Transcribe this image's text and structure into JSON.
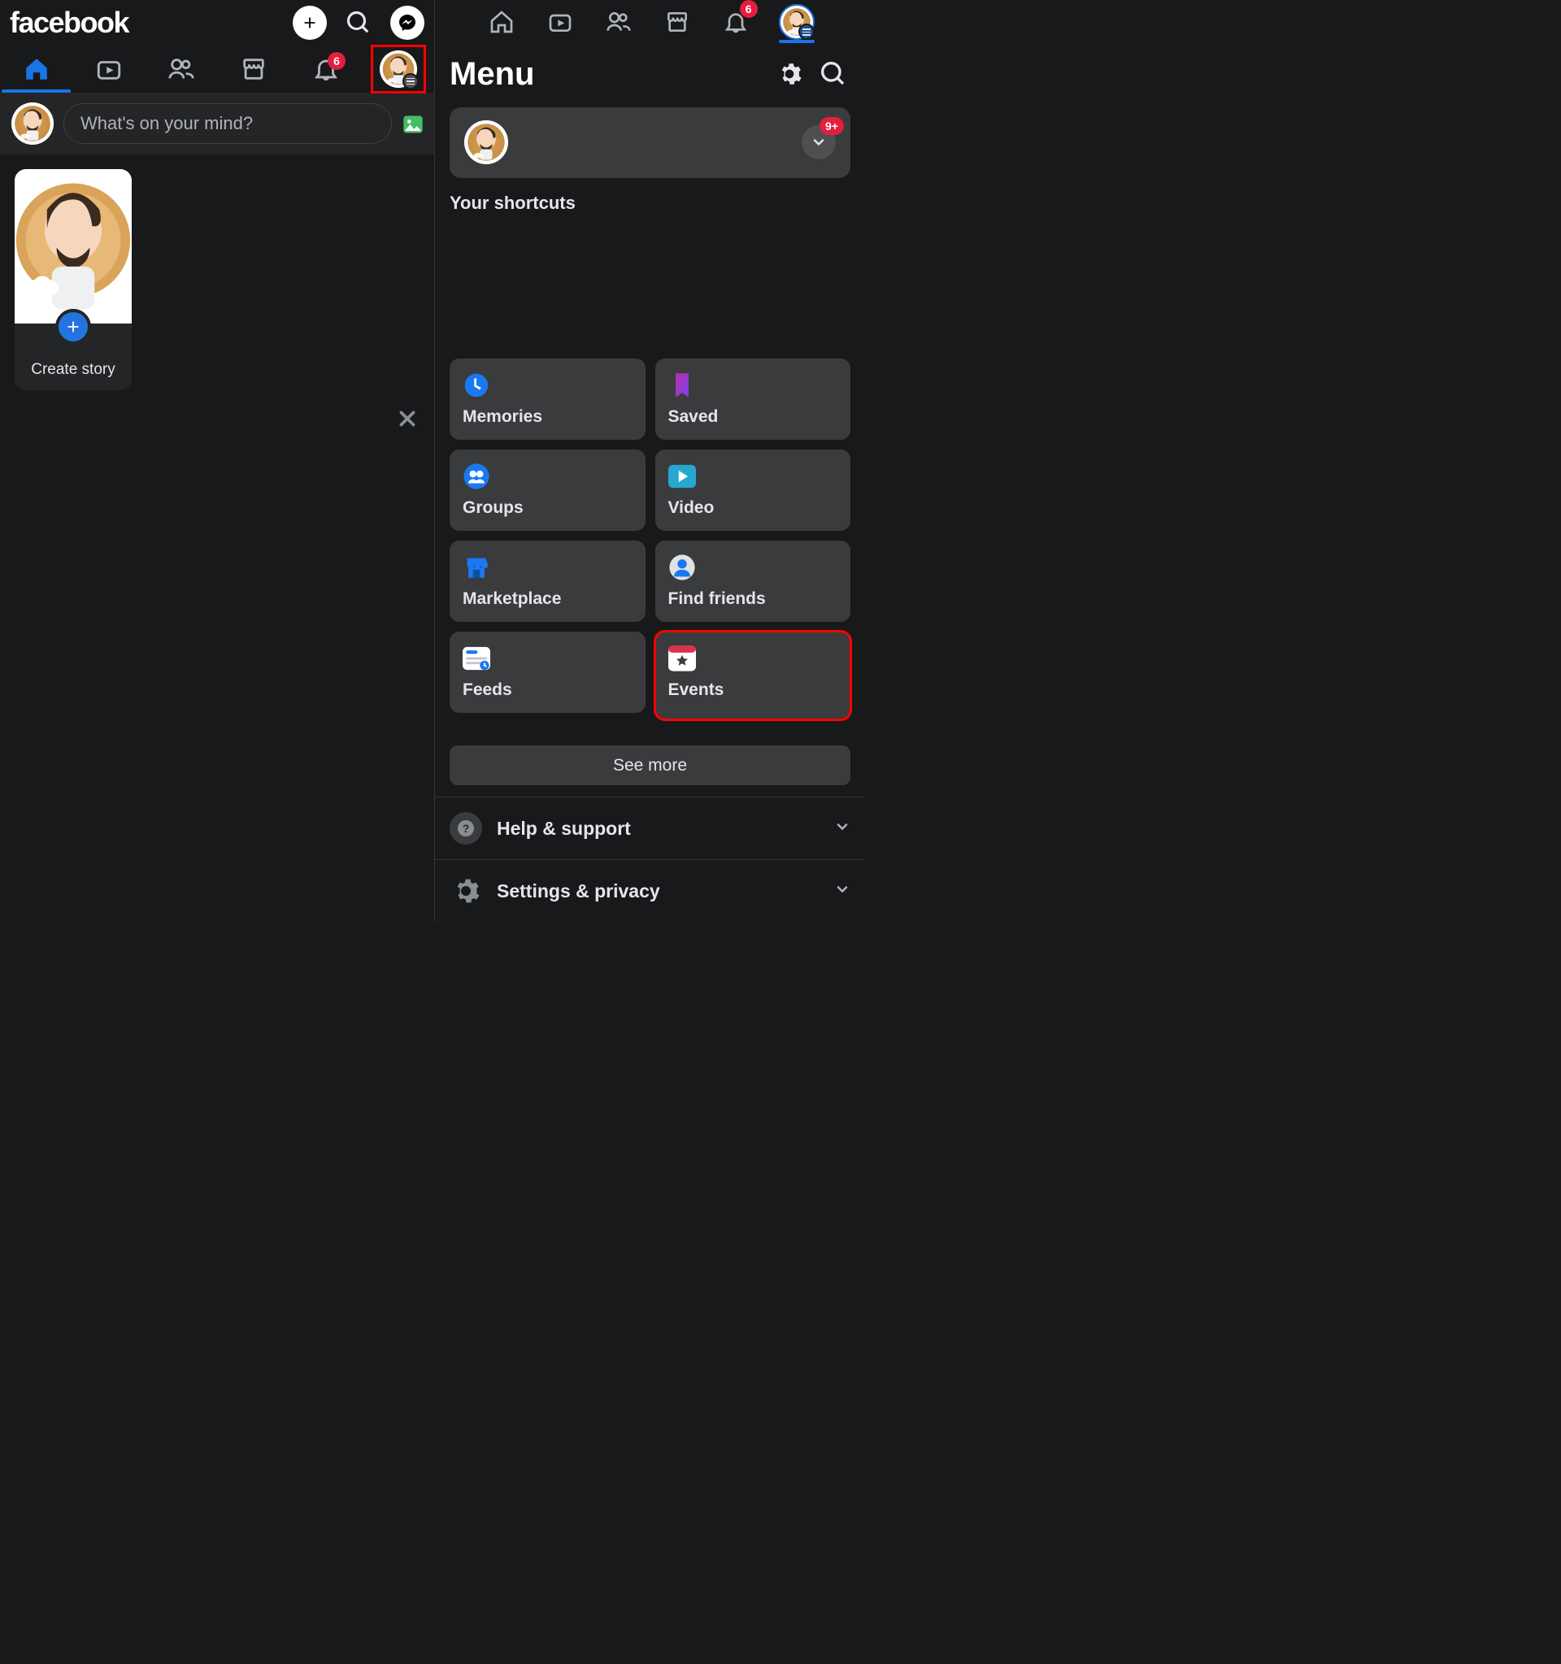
{
  "app_name": "facebook",
  "left": {
    "top_icons": {
      "create": "create-icon",
      "search": "search-icon",
      "messenger": "messenger-icon"
    },
    "nav": {
      "home": {
        "active": true
      },
      "video": {
        "active": false
      },
      "friends": {
        "active": false
      },
      "marketplace": {
        "active": false
      },
      "notifications": {
        "badge": "6"
      },
      "profile_highlighted": true
    },
    "composer": {
      "placeholder": "What's on your mind?"
    },
    "story": {
      "create_label": "Create story"
    }
  },
  "right": {
    "header_notifications_badge": "6",
    "menu_title": "Menu",
    "profile_badge": "9+",
    "shortcuts_label": "Your shortcuts",
    "tiles": [
      {
        "key": "memories",
        "label": "Memories"
      },
      {
        "key": "saved",
        "label": "Saved"
      },
      {
        "key": "groups",
        "label": "Groups"
      },
      {
        "key": "video",
        "label": "Video"
      },
      {
        "key": "marketplace",
        "label": "Marketplace"
      },
      {
        "key": "find-friends",
        "label": "Find friends"
      },
      {
        "key": "feeds",
        "label": "Feeds"
      },
      {
        "key": "events",
        "label": "Events",
        "highlighted": true
      }
    ],
    "see_more_label": "See more",
    "help_label": "Help & support",
    "settings_label": "Settings & privacy"
  }
}
